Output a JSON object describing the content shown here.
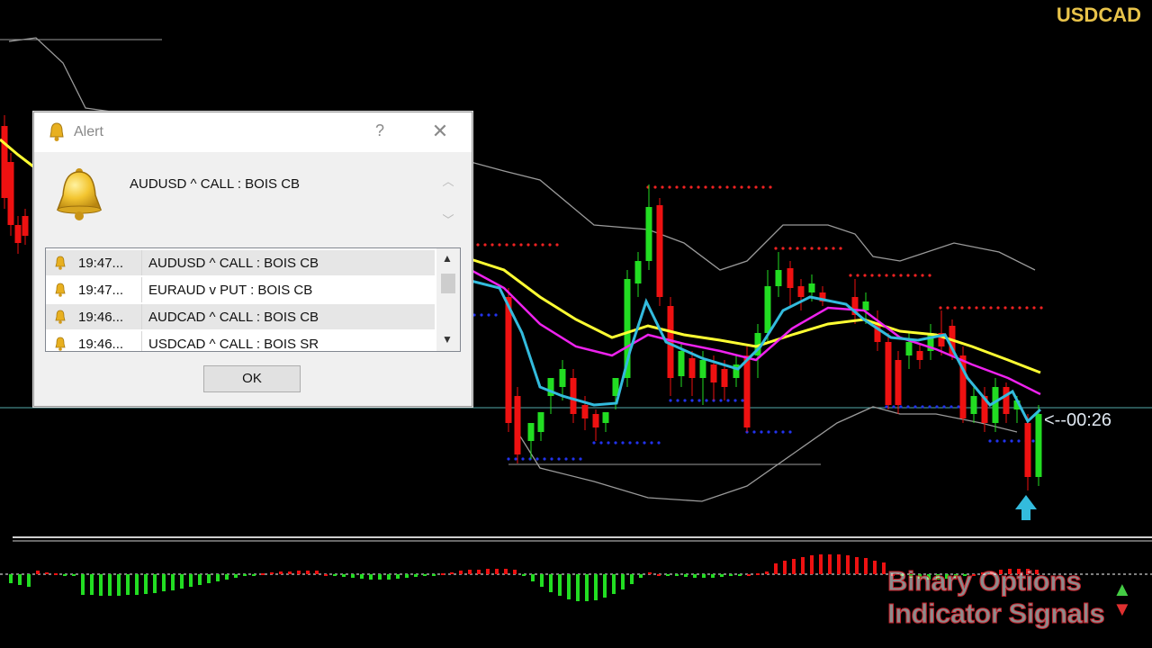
{
  "chart": {
    "symbol": "USDCAD",
    "countdown": "<--00:26",
    "colors": {
      "background": "#000000",
      "bull_candle": "#22dd22",
      "bear_candle": "#ee1111",
      "yellow_ma": "#ffff33",
      "magenta_ma": "#ee22ee",
      "cyan_ma": "#33bbdd",
      "bands": "#9a9a9a",
      "dots_red": "#ee2222",
      "dots_blue": "#2233ee",
      "price_line": "#55aaaa",
      "arrow": "#33bbdd"
    },
    "arrow_icon": "up-arrow-icon"
  },
  "alert_dialog": {
    "title": "Alert",
    "help_label": "?",
    "close_label": "✕",
    "message": "AUDUSD ^ CALL : BOIS CB",
    "rows": [
      {
        "time": "19:47...",
        "message": "AUDUSD ^ CALL : BOIS CB"
      },
      {
        "time": "19:47...",
        "message": "EURAUD v PUT : BOIS CB"
      },
      {
        "time": "19:46...",
        "message": "AUDCAD ^ CALL : BOIS CB"
      },
      {
        "time": "19:46...",
        "message": "USDCAD ^ CALL : BOIS SR"
      }
    ],
    "ok_label": "OK"
  },
  "watermark": {
    "line1": "Binary Options",
    "line2": "Indicator Signals"
  }
}
